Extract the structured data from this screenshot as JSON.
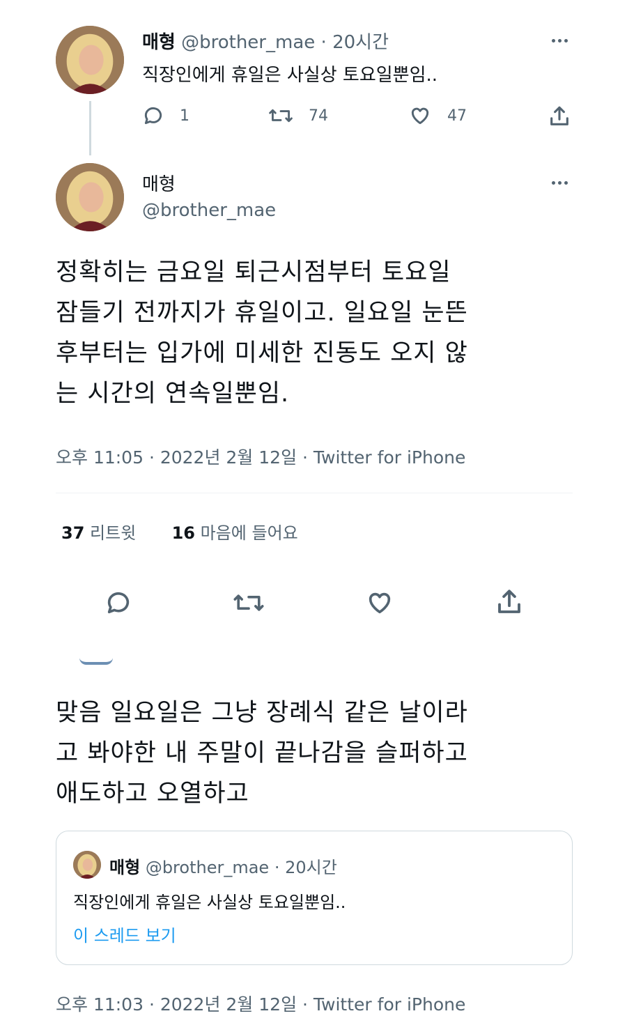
{
  "tweet1": {
    "display_name": "매형",
    "handle": "@brother_mae",
    "time": "20시간",
    "text": "직장인에게 휴일은 사실상 토요일뿐임..",
    "reply_count": "1",
    "retweet_count": "74",
    "like_count": "47"
  },
  "tweet2": {
    "display_name": "매형",
    "handle": "@brother_mae",
    "text_lines": [
      "정확히는 금요일 퇴근시점부터 토요일",
      "잠들기 전까지가 휴일이고. 일요일 눈뜬",
      "후부터는 입가에 미세한 진동도 오지 않",
      "는 시간의 연속일뿐임."
    ],
    "meta": "오후 11:05 · 2022년 2월 12일 · Twitter for iPhone",
    "retweets": "37",
    "retweets_label": "리트윗",
    "likes": "16",
    "likes_label": "마음에 들어요"
  },
  "tweet3": {
    "text_lines": [
      "맞음 일요일은 그냥 장례식 같은 날이라",
      "고 봐야한 내 주말이 끝나감을 슬퍼하고",
      "애도하고 오열하고"
    ],
    "quote": {
      "display_name": "매형",
      "handle": "@brother_mae",
      "time": "20시간",
      "text": "직장인에게 휴일은 사실상 토요일뿐임..",
      "thread_link": "이 스레드 보기"
    },
    "meta": "오후 11:03 · 2022년 2월 12일 · Twitter for iPhone"
  },
  "colors": {
    "text": "#0f1419",
    "secondary": "#536471",
    "link": "#1d9bf0",
    "border": "#cfd9de"
  },
  "icons": [
    "reply-icon",
    "retweet-icon",
    "like-icon",
    "share-icon",
    "more-icon"
  ]
}
